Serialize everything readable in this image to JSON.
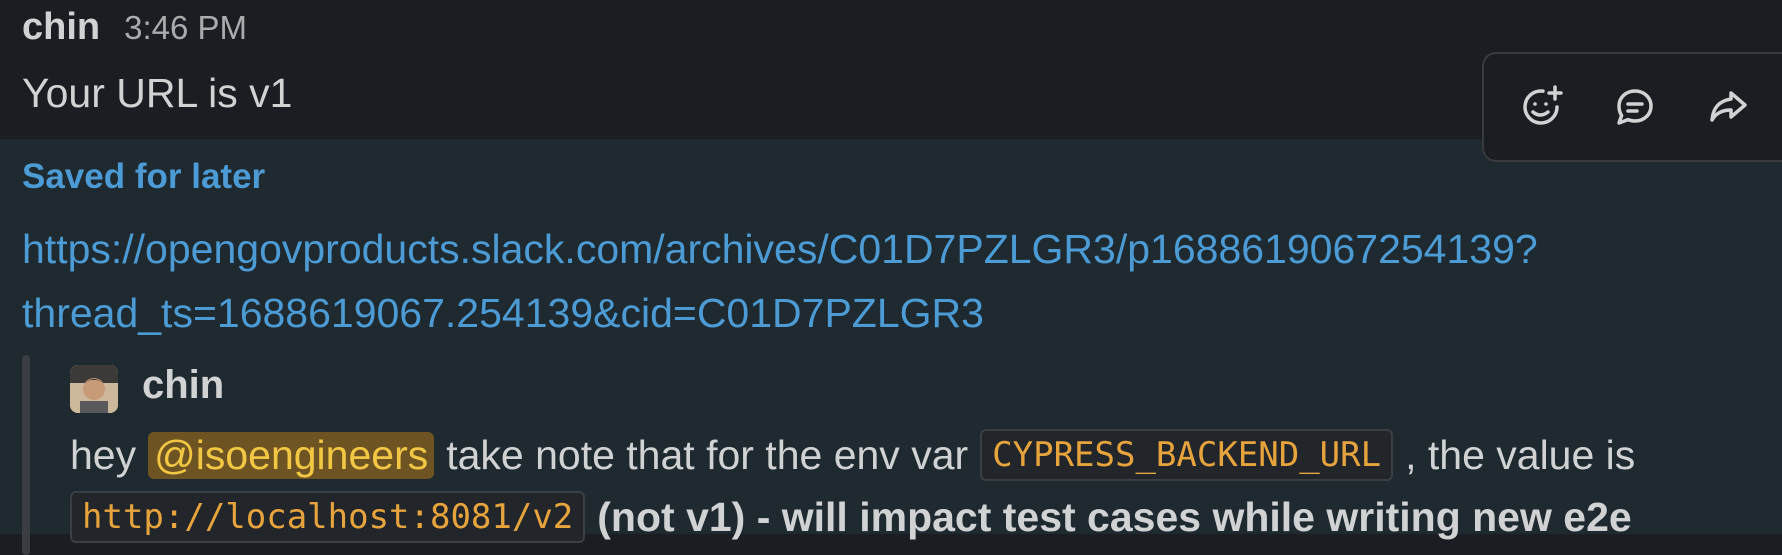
{
  "top_message": {
    "author": "chin",
    "time": "3:46 PM",
    "text": "Your URL is v1"
  },
  "message_actions": {
    "icons": [
      "add-reaction-icon",
      "reply-in-thread-icon",
      "share-message-icon"
    ]
  },
  "saved_message": {
    "saved_label": "Saved for later",
    "link_line1": "https://opengovproducts.slack.com/archives/C01D7PZLGR3/p1688619067254139?",
    "link_line2": "thread_ts=1688619067.254139&cid=C01D7PZLGR3",
    "quote": {
      "author": "chin",
      "text_hey": "hey",
      "mention": "@isoengineers",
      "text_middle": "take note that for the env var",
      "env_var": "CYPRESS_BACKEND_URL",
      "text_after": ", the value is",
      "value_code": "http://localhost:8081/v2",
      "bold_text": "(not v1) - will impact test cases while writing new e2e"
    }
  },
  "colors": {
    "link": "#4c9bd4",
    "mention_bg": "#6f5423",
    "mention_text": "#f2c744",
    "code_text": "#e8a43c",
    "saved_bg": "#1e2930"
  }
}
